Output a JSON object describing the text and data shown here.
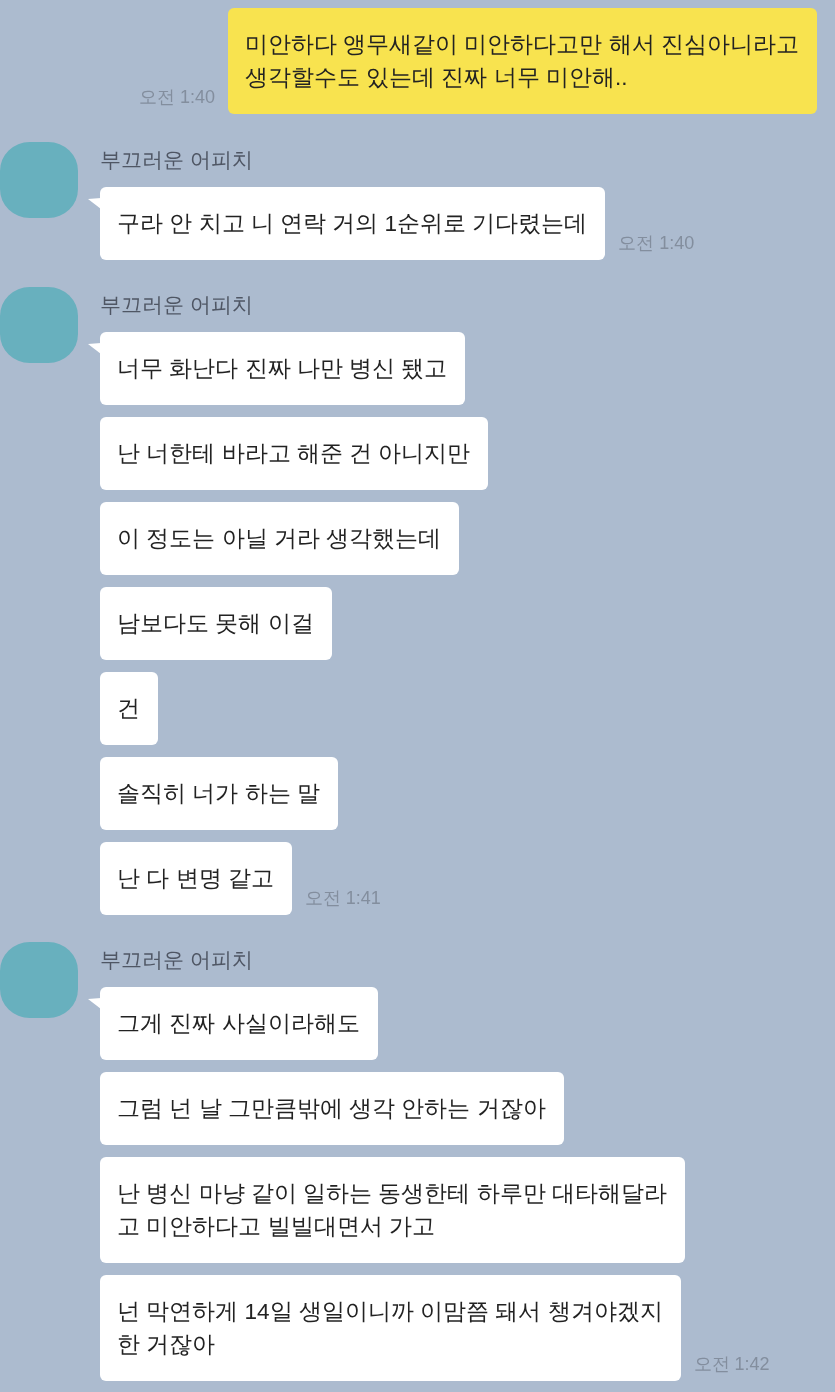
{
  "chat": {
    "messages": [
      {
        "kind": "sent",
        "bubbles": [
          {
            "text": "미안하다 앵무새같이 미안하다고만 해서 진심아니라고\n생각할수도 있는데 진짜 너무 미안해.."
          }
        ],
        "time": "오전 1:40"
      },
      {
        "kind": "received",
        "sender": "부끄러운 어피치",
        "bubbles": [
          {
            "text": "구라 안 치고 니 연락 거의 1순위로 기다렸는데"
          }
        ],
        "time": "오전 1:40"
      },
      {
        "kind": "received",
        "sender": "부끄러운 어피치",
        "bubbles": [
          {
            "text": "너무 화난다 진짜 나만 병신 됐고"
          },
          {
            "text": "난 너한테 바라고 해준 건 아니지만"
          },
          {
            "text": "이 정도는 아닐 거라 생각했는데"
          },
          {
            "text": "남보다도 못해 이걸"
          },
          {
            "text": "건"
          },
          {
            "text": "솔직히 너가 하는 말"
          },
          {
            "text": "난 다 변명 같고"
          }
        ],
        "time": "오전 1:41"
      },
      {
        "kind": "received",
        "sender": "부끄러운 어피치",
        "bubbles": [
          {
            "text": "그게 진짜 사실이라해도"
          },
          {
            "text": "그럼 넌 날 그만큼밖에 생각 안하는 거잖아"
          },
          {
            "text": "난 병신 마냥 같이 일하는 동생한테 하루만 대타해달라\n고 미안하다고 빌빌대면서 가고"
          },
          {
            "text": "넌 막연하게 14일 생일이니까 이맘쯤 돼서 챙겨야겠지\n한 거잖아"
          }
        ],
        "time": "오전 1:42"
      }
    ]
  }
}
